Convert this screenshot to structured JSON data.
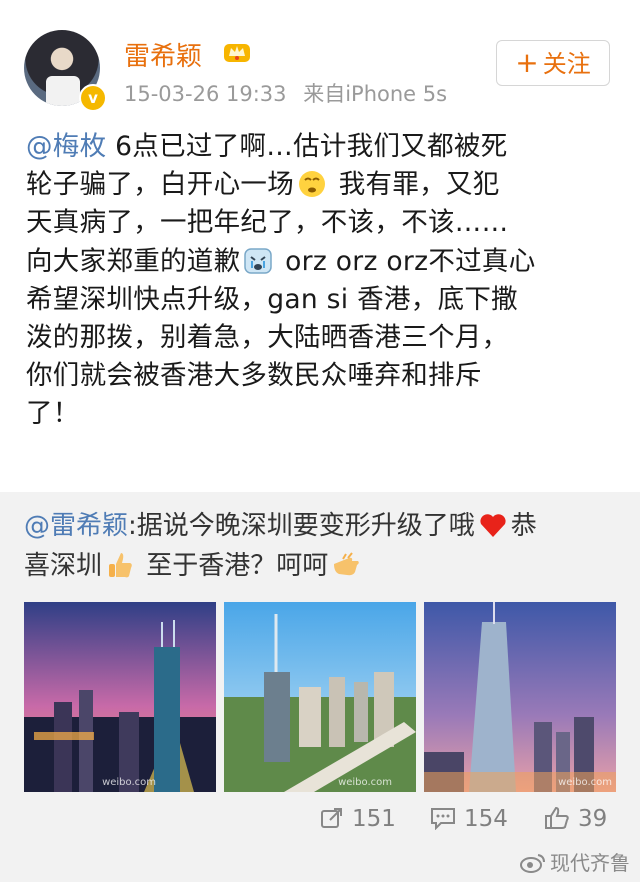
{
  "post": {
    "username": "雷希颖",
    "timestamp": "15-03-26 19:33",
    "source": "来自iPhone 5s",
    "follow_label": "关注",
    "mention": "@梅枚",
    "text_lines": [
      " 6点已过了啊…估计我们又都被死",
      "轮子骗了，白开心一场",
      " 我有罪，又犯",
      "天真病了，一把年纪了，不该，不该……",
      "向大家郑重的道歉",
      " orz orz orz不过真心",
      "希望深圳快点升级，gan si 香港，底下撒",
      "泼的那拨，别着急，大陆晒香港三个月，",
      "你们就会被香港大多数民众唾弃和排斥",
      "了！"
    ]
  },
  "repost": {
    "mention": "@雷希颖",
    "text_1": ":据说今晚深圳要变形升级了哦",
    "text_2": "恭",
    "text_3": "喜深圳",
    "text_4": " 至于香港？呵呵",
    "images": [
      {
        "name": "shenzhen-night-skyline",
        "watermark": "weibo.com"
      },
      {
        "name": "shenzhen-day-city",
        "watermark": "weibo.com"
      },
      {
        "name": "shenzhen-tower-dusk",
        "watermark": "weibo.com"
      }
    ]
  },
  "actions": {
    "repost_count": "151",
    "comment_count": "154",
    "like_count": "39"
  },
  "watermark": "现代齐鲁",
  "colors": {
    "username": "#e8700e",
    "mention": "#4f7cb5",
    "repost_bg": "#f2f2f2",
    "vip_badge": "#f5b800"
  }
}
